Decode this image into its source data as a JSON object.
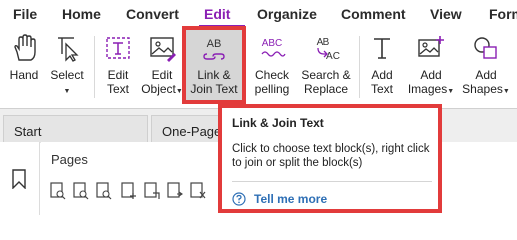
{
  "menu": {
    "items": [
      "File",
      "Home",
      "Convert",
      "Edit",
      "Organize",
      "Comment",
      "View",
      "Form"
    ],
    "active": "Edit",
    "accent_color": "#8a1fb4"
  },
  "ribbon": {
    "tools": [
      {
        "label": "Hand",
        "icon": "hand-icon"
      },
      {
        "label": "Select",
        "icon": "cursor-select-icon",
        "dropdown": true
      },
      {
        "label": "Edit\nText",
        "icon": "edit-text-icon"
      },
      {
        "label": "Edit\nObject",
        "icon": "edit-object-icon",
        "dropdown": true
      },
      {
        "label": "Link &\nJoin Text",
        "icon": "link-join-text-icon",
        "pressed": true
      },
      {
        "label": "Check\npelling",
        "icon": "spell-check-icon"
      },
      {
        "label": "Search &\nReplace",
        "icon": "search-replace-icon"
      },
      {
        "label": "Add\nText",
        "icon": "add-text-icon"
      },
      {
        "label": "Add\nImages",
        "icon": "add-images-icon",
        "dropdown": true
      },
      {
        "label": "Add\nShapes",
        "icon": "add-shapes-icon",
        "dropdown": true
      }
    ],
    "highlight_color": "#e23b3b"
  },
  "tabs": {
    "items": [
      "Start",
      "One-Page-"
    ]
  },
  "pages_panel": {
    "title": "Pages"
  },
  "tooltip": {
    "title": "Link & Join Text",
    "body": "Click to choose text block(s), right click to join or split the block(s)",
    "link_label": "Tell me more",
    "link_color": "#2e6fb5",
    "link_icon": "help-circle-icon"
  }
}
